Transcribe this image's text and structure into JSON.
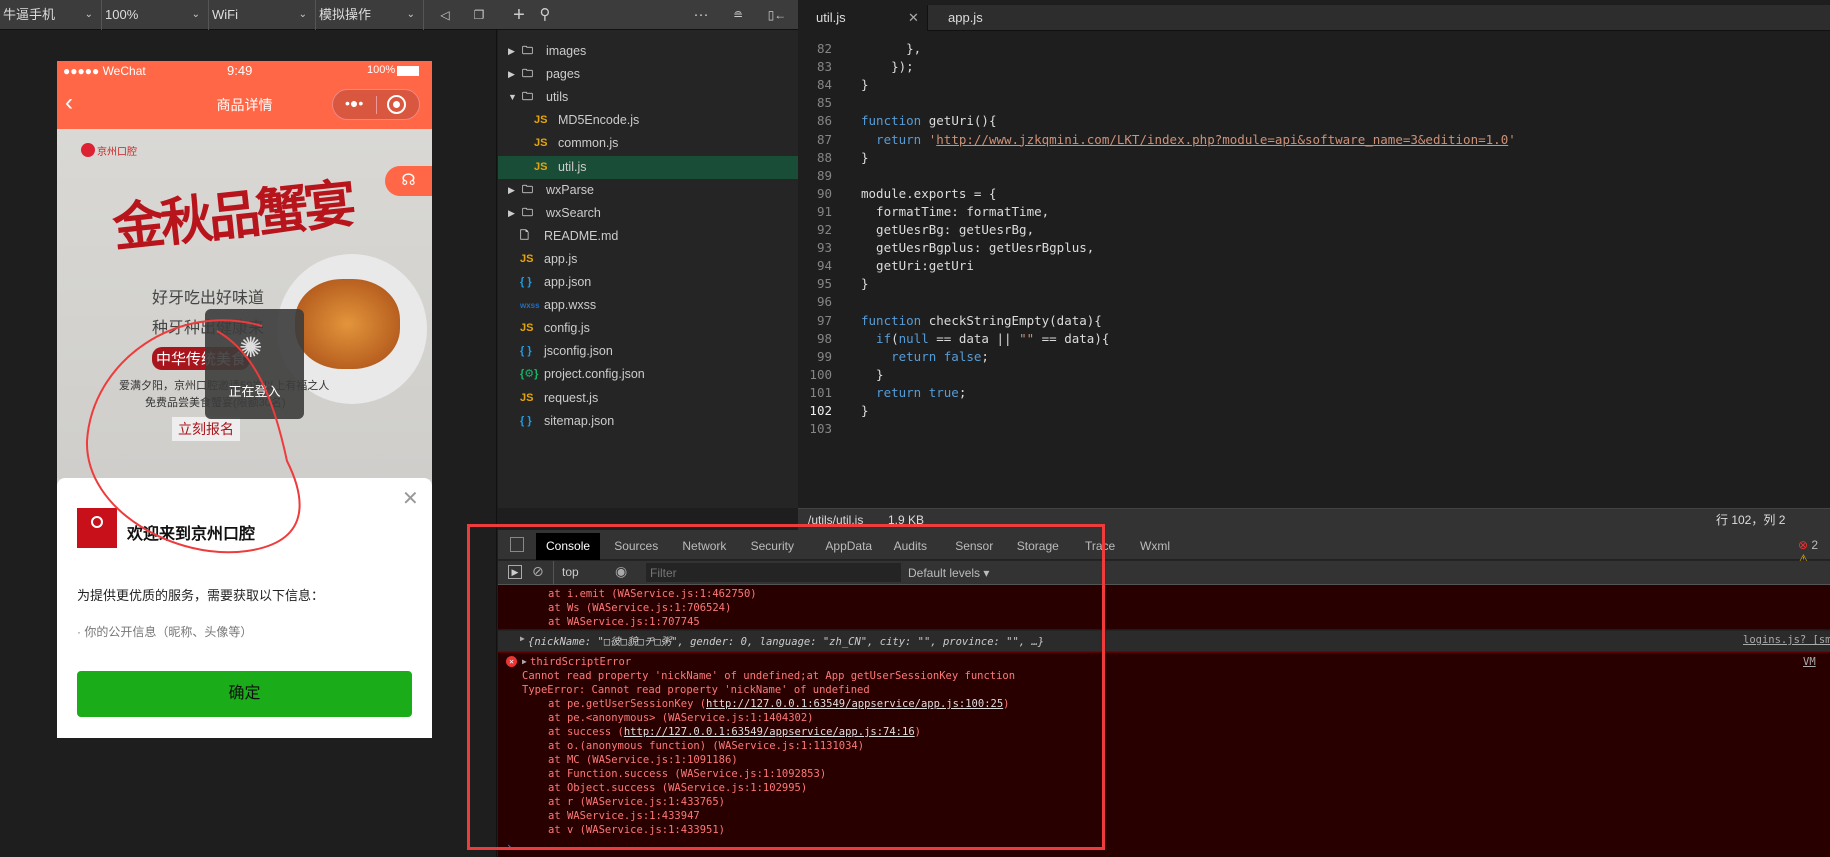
{
  "toolbar": {
    "device": "牛逼手机",
    "zoom": "100%",
    "network": "WiFi",
    "operation": "模拟操作"
  },
  "phone": {
    "status": {
      "carrier": "●●●●● WeChat",
      "time": "9:49",
      "battery": "100%"
    },
    "nav": {
      "title": "商品详情"
    },
    "banner": {
      "logo": "京州口腔",
      "headline": "金秋品蟹宴",
      "line1": "好牙吃出好味道",
      "line2": "种牙种出健康来",
      "badge": "中华传统美食",
      "desc1": "爱满夕阳，京州口腔邀请50岁以上有福之人",
      "desc2": "免费品尝美食蟹宴(限额30名)",
      "cta": "立刻报名"
    },
    "toast": "正在登入",
    "sheet": {
      "title": "欢迎来到京州口腔",
      "desc": "为提供更优质的服务，需要获取以下信息：",
      "item": "· 你的公开信息（昵称、头像等）",
      "confirm": "确定"
    }
  },
  "tree": [
    {
      "name": "images",
      "type": "folder",
      "depth": 0,
      "open": false
    },
    {
      "name": "pages",
      "type": "folder",
      "depth": 0,
      "open": false
    },
    {
      "name": "utils",
      "type": "folder",
      "depth": 0,
      "open": true
    },
    {
      "name": "MD5Encode.js",
      "type": "js",
      "depth": 1
    },
    {
      "name": "common.js",
      "type": "js",
      "depth": 1
    },
    {
      "name": "util.js",
      "type": "js",
      "depth": 1,
      "selected": true
    },
    {
      "name": "wxParse",
      "type": "folder",
      "depth": 0,
      "open": false
    },
    {
      "name": "wxSearch",
      "type": "folder",
      "depth": 0,
      "open": false
    },
    {
      "name": "README.md",
      "type": "file",
      "depth": 0
    },
    {
      "name": "app.js",
      "type": "js",
      "depth": 0
    },
    {
      "name": "app.json",
      "type": "json",
      "depth": 0
    },
    {
      "name": "app.wxss",
      "type": "wxss",
      "depth": 0
    },
    {
      "name": "config.js",
      "type": "js",
      "depth": 0
    },
    {
      "name": "jsconfig.json",
      "type": "json",
      "depth": 0
    },
    {
      "name": "project.config.json",
      "type": "config",
      "depth": 0
    },
    {
      "name": "request.js",
      "type": "js",
      "depth": 0
    },
    {
      "name": "sitemap.json",
      "type": "json",
      "depth": 0
    }
  ],
  "editor": {
    "tabs": [
      {
        "label": "util.js",
        "active": true
      },
      {
        "label": "app.js",
        "active": false
      }
    ],
    "lines": [
      {
        "n": "82",
        "t": [
          [
            "      },",
            ""
          ]
        ]
      },
      {
        "n": "83",
        "t": [
          [
            "    });",
            ""
          ]
        ]
      },
      {
        "n": "84",
        "t": [
          [
            "}",
            ""
          ]
        ]
      },
      {
        "n": "85",
        "t": []
      },
      {
        "n": "86",
        "t": [
          [
            "function",
            "kw"
          ],
          [
            " getUri(){",
            ""
          ]
        ]
      },
      {
        "n": "87",
        "t": [
          [
            "  return ",
            "kw"
          ],
          [
            "'",
            "str2"
          ],
          [
            "http://www.jzkqmini.com/LKT/index.php?module=api&software_name=3&edition=1.0",
            "str"
          ],
          [
            "'",
            "str2"
          ]
        ]
      },
      {
        "n": "88",
        "t": [
          [
            "}",
            ""
          ]
        ]
      },
      {
        "n": "89",
        "t": []
      },
      {
        "n": "90",
        "t": [
          [
            "module.exports = {",
            ""
          ]
        ]
      },
      {
        "n": "91",
        "t": [
          [
            "  formatTime: formatTime,",
            ""
          ]
        ]
      },
      {
        "n": "92",
        "t": [
          [
            "  getUesrBg: getUesrBg,",
            ""
          ]
        ]
      },
      {
        "n": "93",
        "t": [
          [
            "  getUesrBgplus: getUesrBgplus,",
            ""
          ]
        ]
      },
      {
        "n": "94",
        "t": [
          [
            "  getUri:getUri",
            ""
          ]
        ]
      },
      {
        "n": "95",
        "t": [
          [
            "}",
            ""
          ]
        ]
      },
      {
        "n": "96",
        "t": []
      },
      {
        "n": "97",
        "t": [
          [
            "function",
            "kw"
          ],
          [
            " checkStringEmpty(data){",
            ""
          ]
        ]
      },
      {
        "n": "98",
        "t": [
          [
            "  if",
            "kw"
          ],
          [
            "(",
            ""
          ],
          [
            "null",
            "kw"
          ],
          [
            " == data || ",
            ""
          ],
          [
            "\"\"",
            "str2"
          ],
          [
            " == data){",
            ""
          ]
        ]
      },
      {
        "n": "99",
        "t": [
          [
            "    return false",
            "kw"
          ],
          [
            ";",
            ""
          ]
        ]
      },
      {
        "n": "100",
        "t": [
          [
            "  }",
            ""
          ]
        ]
      },
      {
        "n": "101",
        "t": [
          [
            "  return true",
            "kw"
          ],
          [
            ";",
            ""
          ]
        ]
      },
      {
        "n": "102",
        "t": [
          [
            "}",
            ""
          ]
        ]
      },
      {
        "n": "103",
        "t": []
      }
    ],
    "status": {
      "path": "/utils/util.js",
      "size": "1.9 KB",
      "position": "行 102，列 2"
    }
  },
  "devtools": {
    "tabs": [
      "Console",
      "Sources",
      "Network",
      "Security",
      "AppData",
      "Audits",
      "Sensor",
      "Storage",
      "Trace",
      "Wxml"
    ],
    "error_count": "2",
    "context": "top",
    "filter_placeholder": "Filter",
    "levels": "Default levels ▾",
    "pre_lines": [
      "at i.emit (WAService.js:1:462750)",
      "at Ws (WAService.js:1:706524)",
      "at WAService.js:1:707745"
    ],
    "object_line": "{nickName: \"□彼□貌□ヂ□粥\", gender: 0, language: \"zh_CN\", city: \"\", province: \"\", …}",
    "object_source": "logins.js? [sm]",
    "error_title": "thirdScriptError",
    "error_source": "VM",
    "error_lines": [
      "Cannot read property 'nickName' of undefined;at App getUserSessionKey function",
      "TypeError: Cannot read property 'nickName' of undefined"
    ],
    "stack": [
      "at pe.getUserSessionKey (http://127.0.0.1:63549/appservice/app.js:100:25)",
      "at pe.<anonymous> (WAService.js:1:1404302)",
      "at success (http://127.0.0.1:63549/appservice/app.js:74:16)",
      "at o.(anonymous function) (WAService.js:1:1131034)",
      "at MC (WAService.js:1:1091186)",
      "at Function.success (WAService.js:1:1092853)",
      "at Object.success (WAService.js:1:102995)",
      "at r (WAService.js:1:433765)",
      "at WAService.js:1:433947",
      "at v (WAService.js:1:433951)"
    ]
  },
  "colors": {
    "nav": "#ff6747",
    "confirm": "#1aad19",
    "selection": "#1a4d37",
    "error_bg": "#290000",
    "annotation": "#ee3b3b"
  }
}
